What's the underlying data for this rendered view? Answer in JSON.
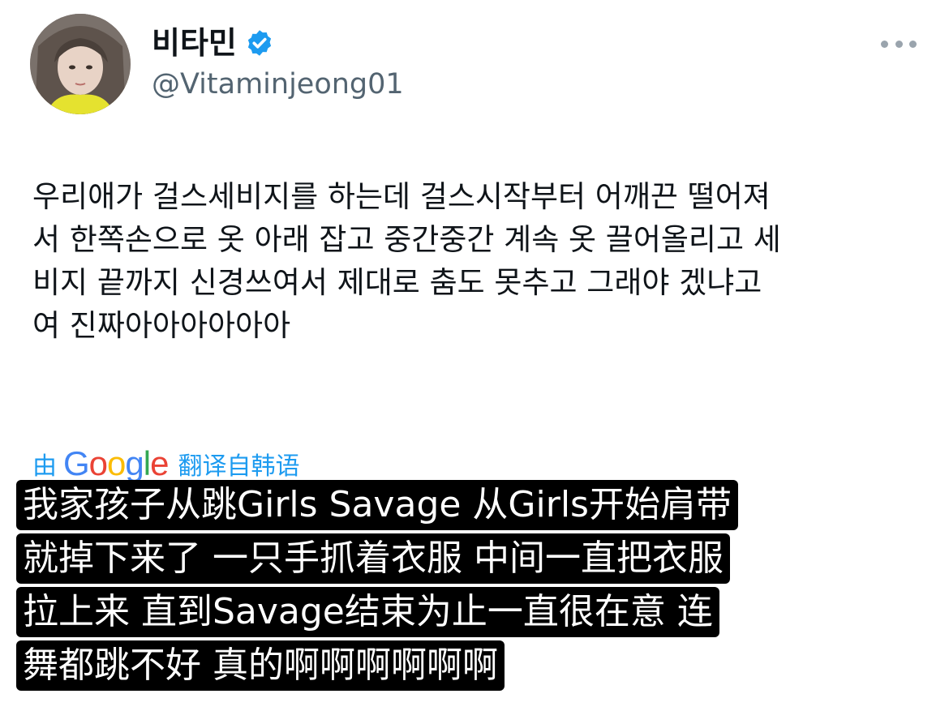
{
  "author": {
    "display_name": "비타민",
    "handle": "@Vitaminjeong01"
  },
  "icons": {
    "verified": "verified-badge-icon",
    "more": "more-options-icon",
    "avatar": "profile-photo"
  },
  "tweet": {
    "lines": [
      "우리애가 걸스세비지를 하는데 걸스시작부터 어깨끈 떨어져",
      "서 한쪽손으로 옷 아래 잡고 중간중간 계속 옷 끌어올리고 세",
      "비지 끝까지 신경쓰여서 제대로 춤도 못추고 그래야 겠냐고",
      "여 진짜아아아아아아"
    ]
  },
  "translation": {
    "by": "由",
    "provider": "Google",
    "from": "翻译自韩语"
  },
  "subtitles": [
    "我家孩子从跳Girls Savage 从Girls开始肩带",
    "就掉下来了 一只手抓着衣服 中间一直把衣服",
    "拉上来 直到Savage结束为止一直很在意 连",
    "舞都跳不好 真的啊啊啊啊啊啊"
  ],
  "colors": {
    "link_blue": "#1d9bf0",
    "verified_blue": "#1d9bf0",
    "handle_gray": "#536471",
    "subtitle_bg": "#000000",
    "subtitle_text": "#ffffff"
  }
}
